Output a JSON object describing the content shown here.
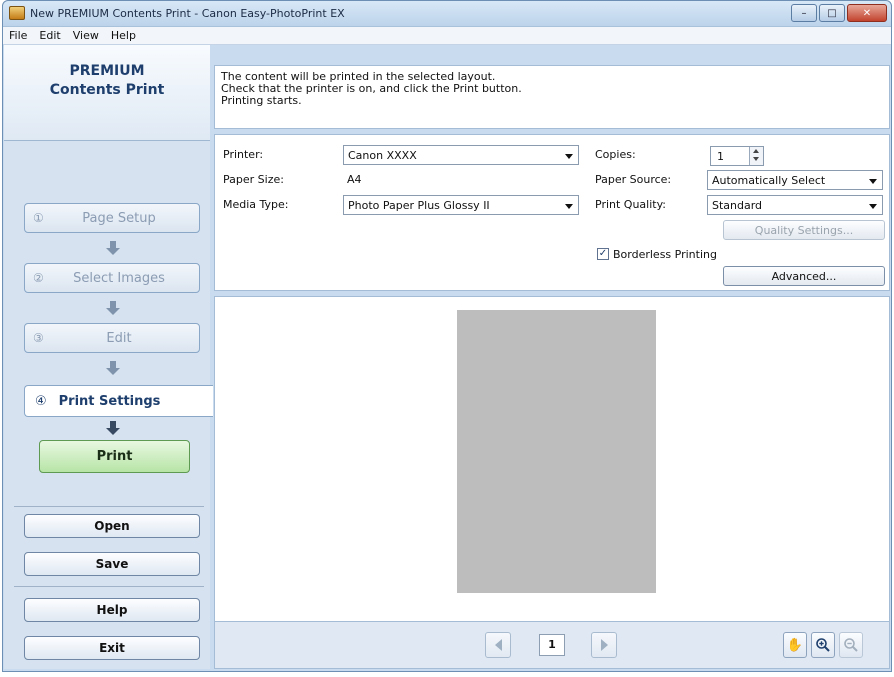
{
  "window": {
    "title": "New PREMIUM Contents Print - Canon Easy-PhotoPrint EX",
    "controls": {
      "minimize": "–",
      "maximize": "□",
      "close": "✕"
    }
  },
  "menu": [
    "File",
    "Edit",
    "View",
    "Help"
  ],
  "sidebar": {
    "heading_line1": "PREMIUM",
    "heading_line2": "Contents Print",
    "steps": [
      {
        "num": "①",
        "label": "Page Setup"
      },
      {
        "num": "②",
        "label": "Select Images"
      },
      {
        "num": "③",
        "label": "Edit"
      },
      {
        "num": "④",
        "label": "Print Settings"
      }
    ],
    "print_label": "Print",
    "open_label": "Open",
    "save_label": "Save",
    "help_label": "Help",
    "exit_label": "Exit"
  },
  "info": {
    "line1": "The content will be printed in the selected layout.",
    "line2": "Check that the printer is on, and click the Print button.",
    "line3": "Printing starts."
  },
  "settings": {
    "printer_label": "Printer:",
    "printer_value": "Canon XXXX",
    "paper_size_label": "Paper Size:",
    "paper_size_value": "A4",
    "media_type_label": "Media Type:",
    "media_type_value": "Photo Paper Plus Glossy II",
    "copies_label": "Copies:",
    "copies_value": "1",
    "paper_source_label": "Paper Source:",
    "paper_source_value": "Automatically Select",
    "print_quality_label": "Print Quality:",
    "print_quality_value": "Standard",
    "quality_settings_label": "Quality Settings...",
    "borderless_label": "Borderless Printing",
    "borderless_checked": true,
    "advanced_label": "Advanced..."
  },
  "preview": {
    "page_number": "1"
  },
  "toolbar_icons": [
    "hand-icon",
    "zoom-in-icon",
    "zoom-out-icon"
  ]
}
